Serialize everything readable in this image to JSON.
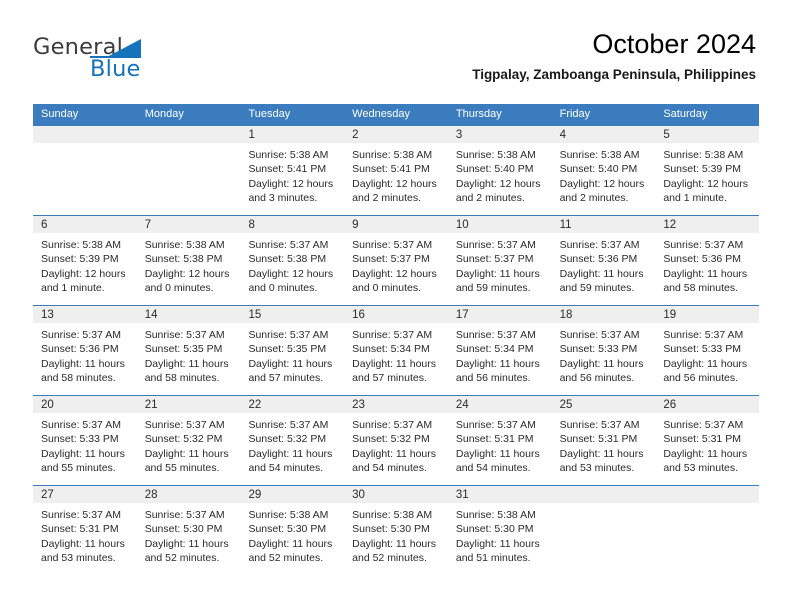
{
  "logo": {
    "word1": "General",
    "word2": "Blue",
    "brand_color": "#1673bb",
    "text_color": "#3c3c3c"
  },
  "header": {
    "title": "October 2024",
    "subtitle": "Tigpalay, Zamboanga Peninsula, Philippines"
  },
  "theme": {
    "header_blue": "#3a7cbe",
    "band_gray": "#efefef",
    "text": "#2b2b2b"
  },
  "weekdays": [
    "Sunday",
    "Monday",
    "Tuesday",
    "Wednesday",
    "Thursday",
    "Friday",
    "Saturday"
  ],
  "weeks": [
    [
      {
        "day": "",
        "sunrise": "",
        "sunset": "",
        "daylight1": "",
        "daylight2": ""
      },
      {
        "day": "",
        "sunrise": "",
        "sunset": "",
        "daylight1": "",
        "daylight2": ""
      },
      {
        "day": "1",
        "sunrise": "Sunrise: 5:38 AM",
        "sunset": "Sunset: 5:41 PM",
        "daylight1": "Daylight: 12 hours",
        "daylight2": "and 3 minutes."
      },
      {
        "day": "2",
        "sunrise": "Sunrise: 5:38 AM",
        "sunset": "Sunset: 5:41 PM",
        "daylight1": "Daylight: 12 hours",
        "daylight2": "and 2 minutes."
      },
      {
        "day": "3",
        "sunrise": "Sunrise: 5:38 AM",
        "sunset": "Sunset: 5:40 PM",
        "daylight1": "Daylight: 12 hours",
        "daylight2": "and 2 minutes."
      },
      {
        "day": "4",
        "sunrise": "Sunrise: 5:38 AM",
        "sunset": "Sunset: 5:40 PM",
        "daylight1": "Daylight: 12 hours",
        "daylight2": "and 2 minutes."
      },
      {
        "day": "5",
        "sunrise": "Sunrise: 5:38 AM",
        "sunset": "Sunset: 5:39 PM",
        "daylight1": "Daylight: 12 hours",
        "daylight2": "and 1 minute."
      }
    ],
    [
      {
        "day": "6",
        "sunrise": "Sunrise: 5:38 AM",
        "sunset": "Sunset: 5:39 PM",
        "daylight1": "Daylight: 12 hours",
        "daylight2": "and 1 minute."
      },
      {
        "day": "7",
        "sunrise": "Sunrise: 5:38 AM",
        "sunset": "Sunset: 5:38 PM",
        "daylight1": "Daylight: 12 hours",
        "daylight2": "and 0 minutes."
      },
      {
        "day": "8",
        "sunrise": "Sunrise: 5:37 AM",
        "sunset": "Sunset: 5:38 PM",
        "daylight1": "Daylight: 12 hours",
        "daylight2": "and 0 minutes."
      },
      {
        "day": "9",
        "sunrise": "Sunrise: 5:37 AM",
        "sunset": "Sunset: 5:37 PM",
        "daylight1": "Daylight: 12 hours",
        "daylight2": "and 0 minutes."
      },
      {
        "day": "10",
        "sunrise": "Sunrise: 5:37 AM",
        "sunset": "Sunset: 5:37 PM",
        "daylight1": "Daylight: 11 hours",
        "daylight2": "and 59 minutes."
      },
      {
        "day": "11",
        "sunrise": "Sunrise: 5:37 AM",
        "sunset": "Sunset: 5:36 PM",
        "daylight1": "Daylight: 11 hours",
        "daylight2": "and 59 minutes."
      },
      {
        "day": "12",
        "sunrise": "Sunrise: 5:37 AM",
        "sunset": "Sunset: 5:36 PM",
        "daylight1": "Daylight: 11 hours",
        "daylight2": "and 58 minutes."
      }
    ],
    [
      {
        "day": "13",
        "sunrise": "Sunrise: 5:37 AM",
        "sunset": "Sunset: 5:36 PM",
        "daylight1": "Daylight: 11 hours",
        "daylight2": "and 58 minutes."
      },
      {
        "day": "14",
        "sunrise": "Sunrise: 5:37 AM",
        "sunset": "Sunset: 5:35 PM",
        "daylight1": "Daylight: 11 hours",
        "daylight2": "and 58 minutes."
      },
      {
        "day": "15",
        "sunrise": "Sunrise: 5:37 AM",
        "sunset": "Sunset: 5:35 PM",
        "daylight1": "Daylight: 11 hours",
        "daylight2": "and 57 minutes."
      },
      {
        "day": "16",
        "sunrise": "Sunrise: 5:37 AM",
        "sunset": "Sunset: 5:34 PM",
        "daylight1": "Daylight: 11 hours",
        "daylight2": "and 57 minutes."
      },
      {
        "day": "17",
        "sunrise": "Sunrise: 5:37 AM",
        "sunset": "Sunset: 5:34 PM",
        "daylight1": "Daylight: 11 hours",
        "daylight2": "and 56 minutes."
      },
      {
        "day": "18",
        "sunrise": "Sunrise: 5:37 AM",
        "sunset": "Sunset: 5:33 PM",
        "daylight1": "Daylight: 11 hours",
        "daylight2": "and 56 minutes."
      },
      {
        "day": "19",
        "sunrise": "Sunrise: 5:37 AM",
        "sunset": "Sunset: 5:33 PM",
        "daylight1": "Daylight: 11 hours",
        "daylight2": "and 56 minutes."
      }
    ],
    [
      {
        "day": "20",
        "sunrise": "Sunrise: 5:37 AM",
        "sunset": "Sunset: 5:33 PM",
        "daylight1": "Daylight: 11 hours",
        "daylight2": "and 55 minutes."
      },
      {
        "day": "21",
        "sunrise": "Sunrise: 5:37 AM",
        "sunset": "Sunset: 5:32 PM",
        "daylight1": "Daylight: 11 hours",
        "daylight2": "and 55 minutes."
      },
      {
        "day": "22",
        "sunrise": "Sunrise: 5:37 AM",
        "sunset": "Sunset: 5:32 PM",
        "daylight1": "Daylight: 11 hours",
        "daylight2": "and 54 minutes."
      },
      {
        "day": "23",
        "sunrise": "Sunrise: 5:37 AM",
        "sunset": "Sunset: 5:32 PM",
        "daylight1": "Daylight: 11 hours",
        "daylight2": "and 54 minutes."
      },
      {
        "day": "24",
        "sunrise": "Sunrise: 5:37 AM",
        "sunset": "Sunset: 5:31 PM",
        "daylight1": "Daylight: 11 hours",
        "daylight2": "and 54 minutes."
      },
      {
        "day": "25",
        "sunrise": "Sunrise: 5:37 AM",
        "sunset": "Sunset: 5:31 PM",
        "daylight1": "Daylight: 11 hours",
        "daylight2": "and 53 minutes."
      },
      {
        "day": "26",
        "sunrise": "Sunrise: 5:37 AM",
        "sunset": "Sunset: 5:31 PM",
        "daylight1": "Daylight: 11 hours",
        "daylight2": "and 53 minutes."
      }
    ],
    [
      {
        "day": "27",
        "sunrise": "Sunrise: 5:37 AM",
        "sunset": "Sunset: 5:31 PM",
        "daylight1": "Daylight: 11 hours",
        "daylight2": "and 53 minutes."
      },
      {
        "day": "28",
        "sunrise": "Sunrise: 5:37 AM",
        "sunset": "Sunset: 5:30 PM",
        "daylight1": "Daylight: 11 hours",
        "daylight2": "and 52 minutes."
      },
      {
        "day": "29",
        "sunrise": "Sunrise: 5:38 AM",
        "sunset": "Sunset: 5:30 PM",
        "daylight1": "Daylight: 11 hours",
        "daylight2": "and 52 minutes."
      },
      {
        "day": "30",
        "sunrise": "Sunrise: 5:38 AM",
        "sunset": "Sunset: 5:30 PM",
        "daylight1": "Daylight: 11 hours",
        "daylight2": "and 52 minutes."
      },
      {
        "day": "31",
        "sunrise": "Sunrise: 5:38 AM",
        "sunset": "Sunset: 5:30 PM",
        "daylight1": "Daylight: 11 hours",
        "daylight2": "and 51 minutes."
      },
      {
        "day": "",
        "sunrise": "",
        "sunset": "",
        "daylight1": "",
        "daylight2": ""
      },
      {
        "day": "",
        "sunrise": "",
        "sunset": "",
        "daylight1": "",
        "daylight2": ""
      }
    ]
  ]
}
